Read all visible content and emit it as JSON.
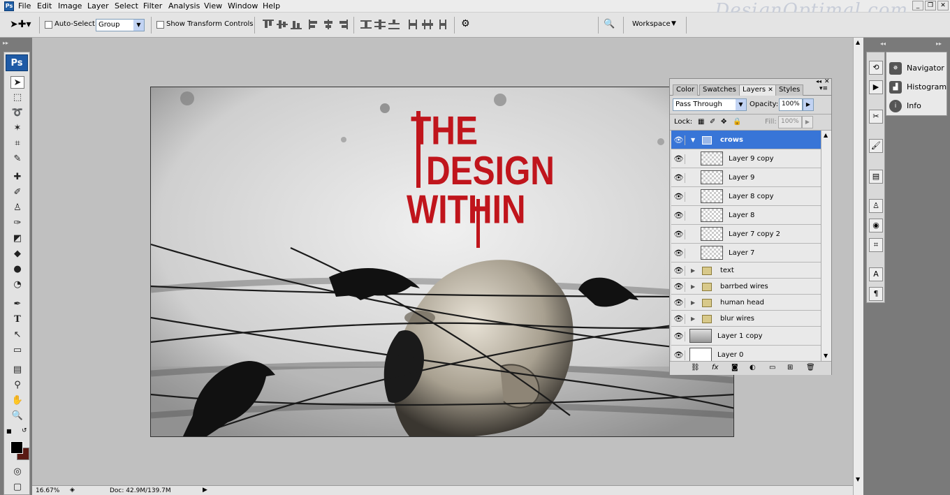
{
  "menubar": {
    "items": [
      "File",
      "Edit",
      "Image",
      "Layer",
      "Select",
      "Filter",
      "Analysis",
      "View",
      "Window",
      "Help"
    ],
    "watermark": "DesignOptimal.com"
  },
  "options": {
    "auto_select_label": "Auto-Select:",
    "auto_select_value": "Group",
    "show_transform_label": "Show Transform Controls",
    "workspace_label": "Workspace"
  },
  "toolbox": {
    "logo": "Ps",
    "tools": [
      "move-tool",
      "marquee-tool",
      "lasso-tool",
      "magic-wand-tool",
      "crop-tool",
      "eyedropper-tool",
      "healing-brush-tool",
      "brush-tool",
      "clone-stamp-tool",
      "history-brush-tool",
      "eraser-tool",
      "paint-bucket-tool",
      "blur-tool",
      "dodge-tool",
      "pen-tool",
      "type-tool",
      "path-selection-tool",
      "shape-tool",
      "notes-tool",
      "eyedropper-3d-tool",
      "hand-tool",
      "zoom-tool"
    ],
    "fg_color": "#000000",
    "bg_color": "#5a1a14"
  },
  "document": {
    "title_lines": [
      "THE",
      "DESIGN",
      "WITHIN"
    ],
    "title_color": "#c0151c"
  },
  "status": {
    "zoom": "16.67%",
    "doc_size": "Doc: 42.9M/139.7M"
  },
  "right_panel": {
    "items": [
      "Navigator",
      "Histogram",
      "Info"
    ]
  },
  "layers_panel": {
    "tabs": [
      "Color",
      "Swatches",
      "Layers",
      "Styles"
    ],
    "blend_mode": "Pass Through",
    "opacity_label": "Opacity:",
    "opacity_value": "100%",
    "lock_label": "Lock:",
    "fill_label": "Fill:",
    "fill_value": "100%",
    "layers": [
      {
        "name": "crows",
        "type": "group",
        "open": true,
        "selected": true
      },
      {
        "name": "Layer 9 copy",
        "type": "layer",
        "indent": true
      },
      {
        "name": "Layer 9",
        "type": "layer",
        "indent": true
      },
      {
        "name": "Layer 8 copy",
        "type": "layer",
        "indent": true
      },
      {
        "name": "Layer 8",
        "type": "layer",
        "indent": true
      },
      {
        "name": "Layer 7 copy 2",
        "type": "layer",
        "indent": true
      },
      {
        "name": "Layer 7",
        "type": "layer",
        "indent": true
      },
      {
        "name": "text",
        "type": "group"
      },
      {
        "name": "barrbed wires",
        "type": "group"
      },
      {
        "name": "human head",
        "type": "group"
      },
      {
        "name": "blur wires",
        "type": "group"
      },
      {
        "name": "Layer 1 copy",
        "type": "layer"
      },
      {
        "name": "Layer 0",
        "type": "layer",
        "white": true
      }
    ]
  }
}
